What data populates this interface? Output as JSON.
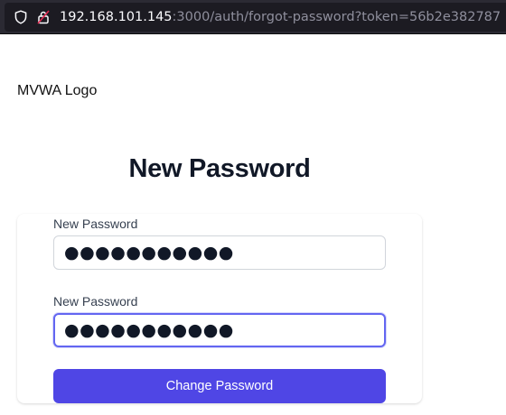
{
  "browser": {
    "url_host": "192.168.101.145",
    "url_rest": ":3000/auth/forgot-password?token=56b2e382787",
    "icons": [
      "shield-icon",
      "lock-icon"
    ]
  },
  "page": {
    "logo_text": "MVWA Logo",
    "title": "New Password",
    "form": {
      "field1_label": "New Password",
      "field1_value": "●●●●●●●●●●●",
      "field2_label": "New Password",
      "field2_value": "●●●●●●●●●●●",
      "submit_label": "Change Password"
    }
  },
  "colors": {
    "accent": "#4f46e5",
    "focus_ring": "#6366f1",
    "title": "#111827"
  }
}
